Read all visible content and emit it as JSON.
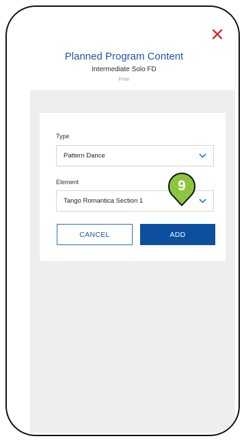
{
  "dialog": {
    "title": "Planned Program Content",
    "subtitle": "Intermediate Solo FD",
    "caption": "Free"
  },
  "form": {
    "type_label": "Type",
    "type_value": "Pattern Dance",
    "element_label": "Element",
    "element_value": "Tango Romantica Section 1",
    "cancel_label": "CANCEL",
    "add_label": "ADD"
  },
  "step_badge": {
    "number": "9"
  },
  "icons": {
    "close": "close-icon",
    "chevron": "chevron-down-icon",
    "pointer": "cursor-arrow-icon"
  },
  "colors": {
    "accent": "#1d56a5",
    "primary_button": "#0b4f9e",
    "close": "#e0262d",
    "badge_fill": "#8cc63f",
    "panel_bg": "#eeeeee"
  }
}
